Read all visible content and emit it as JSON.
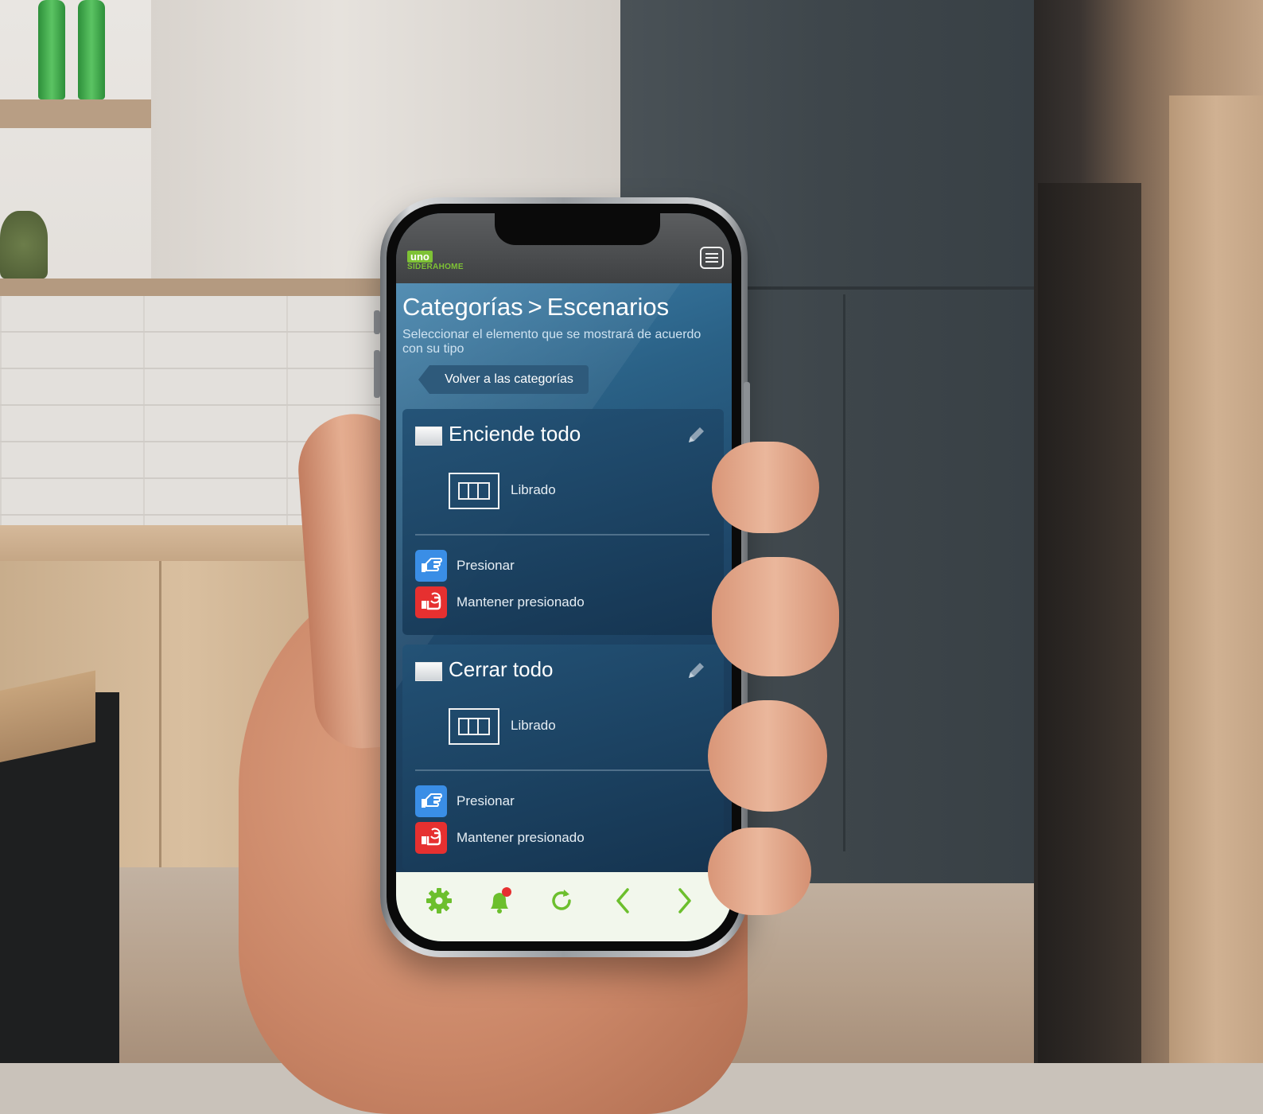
{
  "app": {
    "logo_mark": "uno",
    "logo_text": "SIDERAHOME"
  },
  "header": {
    "breadcrumb_root": "Categorías",
    "breadcrumb_sep": ">",
    "breadcrumb_current": "Escenarios",
    "subtitle": "Seleccionar el elemento que se mostrará de acuerdo con su tipo",
    "back_label": "Volver a las categorías"
  },
  "scenes": [
    {
      "title": "Enciende todo",
      "device_label": "Librado",
      "actions": [
        {
          "label": "Presionar",
          "icon": "press-hand-icon",
          "color": "#3a8ee6"
        },
        {
          "label": "Mantener presionado",
          "icon": "hold-hand-icon",
          "color": "#e63030"
        }
      ]
    },
    {
      "title": "Cerrar todo",
      "device_label": "Librado",
      "actions": [
        {
          "label": "Presionar",
          "icon": "press-hand-icon",
          "color": "#3a8ee6"
        },
        {
          "label": "Mantener presionado",
          "icon": "hold-hand-icon",
          "color": "#e63030"
        }
      ]
    }
  ],
  "bottom_nav": [
    {
      "icon": "gear-icon",
      "glyph": "⚙"
    },
    {
      "icon": "bell-alert-icon",
      "glyph": ""
    },
    {
      "icon": "refresh-icon",
      "glyph": "⟳"
    },
    {
      "icon": "chevron-left-icon",
      "glyph": "‹"
    },
    {
      "icon": "chevron-right-icon",
      "glyph": "›"
    }
  ],
  "colors": {
    "accent_green": "#6cbf2d",
    "press_blue": "#3a8ee6",
    "hold_red": "#e63030"
  }
}
